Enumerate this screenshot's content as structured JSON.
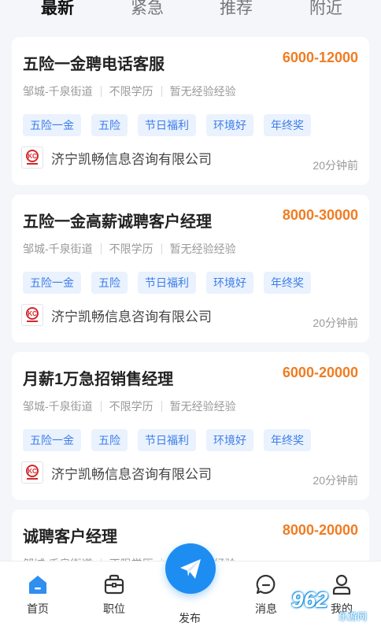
{
  "tabs": [
    {
      "label": "最新",
      "active": true
    },
    {
      "label": "紧急",
      "active": false
    },
    {
      "label": "推荐",
      "active": false
    },
    {
      "label": "附近",
      "active": false
    }
  ],
  "jobs": [
    {
      "title": "五险一金聘电话客服",
      "salary": "6000-12000",
      "location": "邹城-千泉街道",
      "education": "不限学历",
      "experience": "暂无经验经验",
      "tags": [
        "五险一金",
        "五险",
        "节日福利",
        "环境好",
        "年终奖"
      ],
      "company": "济宁凯畅信息咨询有限公司",
      "time": "20分钟前"
    },
    {
      "title": "五险一金高薪诚聘客户经理",
      "salary": "8000-30000",
      "location": "邹城-千泉街道",
      "education": "不限学历",
      "experience": "暂无经验经验",
      "tags": [
        "五险一金",
        "五险",
        "节日福利",
        "环境好",
        "年终奖"
      ],
      "company": "济宁凯畅信息咨询有限公司",
      "time": "20分钟前"
    },
    {
      "title": "月薪1万急招销售经理",
      "salary": "6000-20000",
      "location": "邹城-千泉街道",
      "education": "不限学历",
      "experience": "暂无经验经验",
      "tags": [
        "五险一金",
        "五险",
        "节日福利",
        "环境好",
        "年终奖"
      ],
      "company": "济宁凯畅信息咨询有限公司",
      "time": "20分钟前"
    },
    {
      "title": "诚聘客户经理",
      "salary": "8000-20000",
      "location": "邹城-千泉街道",
      "education": "不限学历",
      "experience": "暂无经验经验",
      "tags": [],
      "company": "",
      "time": ""
    }
  ],
  "nav": {
    "home": "首页",
    "jobs": "职位",
    "post": "发布",
    "messages": "消息",
    "me": "我的"
  },
  "watermark": {
    "main": "962",
    "sub": "乐游网"
  },
  "colors": {
    "accent": "#1e8df2",
    "salary": "#f07c22",
    "tag_bg": "#eaf2fe",
    "tag_text": "#3d7ee8"
  },
  "icons": {
    "home": "home-icon",
    "jobs": "briefcase-icon",
    "post": "paper-plane-icon",
    "messages": "chat-bubble-icon",
    "me": "user-icon",
    "company_logo": "kc-logo"
  }
}
